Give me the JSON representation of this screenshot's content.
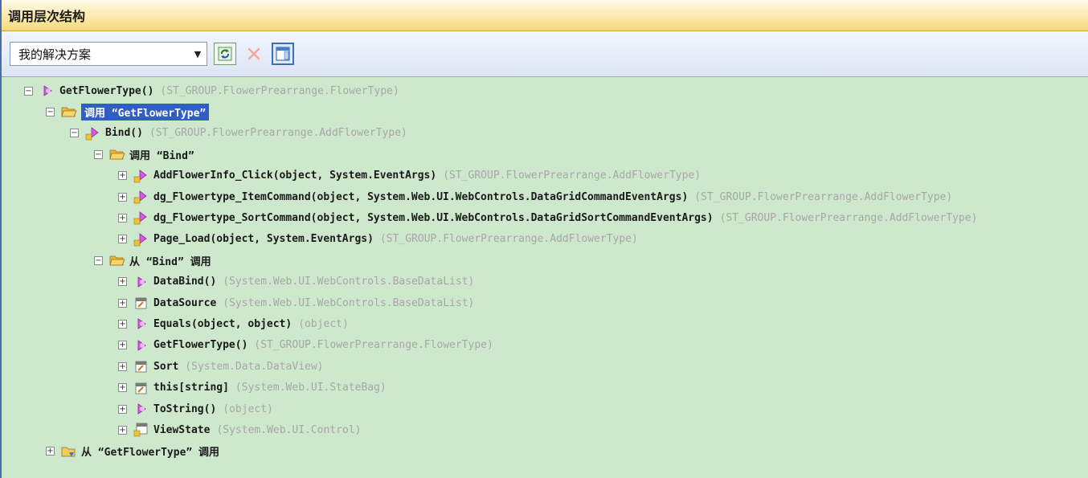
{
  "window": {
    "title": "调用层次结构"
  },
  "toolbar": {
    "scope": "我的解决方案",
    "icons": [
      "refresh-icon",
      "delete-icon",
      "toggle-details-icon"
    ]
  },
  "tree": {
    "rows": [
      {
        "expander": "−",
        "icon": "method-icon",
        "name": "GetFlowerType()",
        "type": "(ST_GROUP.FlowerPrearrange.FlowerType)"
      },
      {
        "expander": "−",
        "icon": "folder-open-icon",
        "name": "调用 “GetFlowerType”",
        "type": ""
      },
      {
        "expander": "−",
        "icon": "method-protected-icon",
        "name": "Bind()",
        "type": "(ST_GROUP.FlowerPrearrange.AddFlowerType)"
      },
      {
        "expander": "−",
        "icon": "folder-open-icon",
        "name": "调用 “Bind”",
        "type": ""
      },
      {
        "expander": "+",
        "icon": "method-protected-icon",
        "name": "AddFlowerInfo_Click(object, System.EventArgs)",
        "type": "(ST_GROUP.FlowerPrearrange.AddFlowerType)"
      },
      {
        "expander": "+",
        "icon": "method-protected-icon",
        "name": "dg_Flowertype_ItemCommand(object, System.Web.UI.WebControls.DataGridCommandEventArgs)",
        "type": "(ST_GROUP.FlowerPrearrange.AddFlowerType)"
      },
      {
        "expander": "+",
        "icon": "method-protected-icon",
        "name": "dg_Flowertype_SortCommand(object, System.Web.UI.WebControls.DataGridSortCommandEventArgs)",
        "type": "(ST_GROUP.FlowerPrearrange.AddFlowerType)"
      },
      {
        "expander": "+",
        "icon": "method-protected-icon",
        "name": "Page_Load(object, System.EventArgs)",
        "type": "(ST_GROUP.FlowerPrearrange.AddFlowerType)"
      },
      {
        "expander": "−",
        "icon": "folder-open-icon",
        "name": "从 “Bind” 调用",
        "type": ""
      },
      {
        "expander": "+",
        "icon": "method-icon",
        "name": "DataBind()",
        "type": "(System.Web.UI.WebControls.BaseDataList)"
      },
      {
        "expander": "+",
        "icon": "property-icon",
        "name": "DataSource",
        "type": "(System.Web.UI.WebControls.BaseDataList)"
      },
      {
        "expander": "+",
        "icon": "method-icon",
        "name": "Equals(object, object)",
        "type": "(object)"
      },
      {
        "expander": "+",
        "icon": "method-icon",
        "name": "GetFlowerType()",
        "type": "(ST_GROUP.FlowerPrearrange.FlowerType)"
      },
      {
        "expander": "+",
        "icon": "property-icon",
        "name": "Sort",
        "type": "(System.Data.DataView)"
      },
      {
        "expander": "+",
        "icon": "property-icon",
        "name": "this[string]",
        "type": "(System.Web.UI.StateBag)"
      },
      {
        "expander": "+",
        "icon": "method-icon",
        "name": "ToString()",
        "type": "(object)"
      },
      {
        "expander": "+",
        "icon": "property-protected-icon",
        "name": "ViewState",
        "type": "(System.Web.UI.Control)"
      },
      {
        "expander": "+",
        "icon": "folder-closed-icon",
        "name": "从 “GetFlowerType” 调用",
        "type": ""
      }
    ]
  },
  "colors": {
    "tree_background": "#cde8cc",
    "selection": "#2f5fc4",
    "type_text": "#a7a7a7",
    "title_bar": "#fbe8a6"
  }
}
